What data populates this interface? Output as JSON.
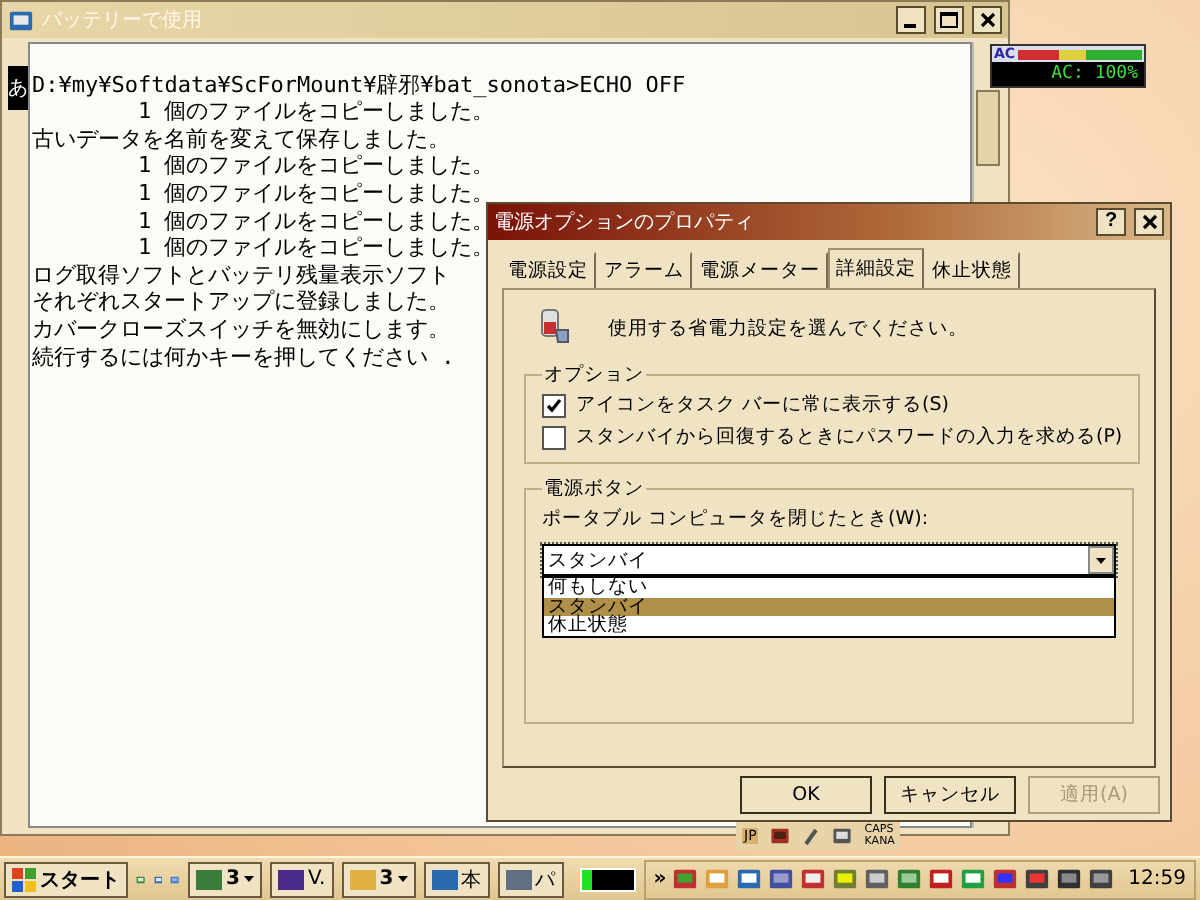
{
  "console": {
    "title": "バッテリーで使用",
    "ime": "あ",
    "lines": [
      "D:¥my¥Softdata¥ScForMount¥辟邪¥bat_sonota>ECHO OFF",
      "        1 個のファイルをコピーしました。",
      "古いデータを名前を変えて保存しました。",
      "        1 個のファイルをコピーしました。",
      "        1 個のファイルをコピーしました。",
      "        1 個のファイルをコピーしました。",
      "        1 個のファイルをコピーしました。",
      "ログ取得ソフトとバッテリ残量表示ソフト",
      "それぞれスタートアップに登録しました。",
      "カバークローズスイッチを無効にします。",
      "続行するには何かキーを押してください ."
    ]
  },
  "battery_meter": {
    "label": "AC",
    "reading": "AC: 100%",
    "level": 1
  },
  "dialog": {
    "title": "電源オプションのプロパティ",
    "help": "?",
    "tabs": [
      {
        "label": "電源設定",
        "selected": false
      },
      {
        "label": "アラーム",
        "selected": false
      },
      {
        "label": "電源メーター",
        "selected": false
      },
      {
        "label": "詳細設定",
        "selected": true
      },
      {
        "label": "休止状態",
        "selected": false
      }
    ],
    "description": "使用する省電力設定を選んでください。",
    "options": {
      "title": "オプション",
      "checkboxes": [
        {
          "label": "アイコンをタスク バーに常に表示する(S)",
          "checked": true
        },
        {
          "label": "スタンバイから回復するときにパスワードの入力を求める(P)",
          "checked": false
        }
      ]
    },
    "power_button": {
      "title": "電源ボタン",
      "label": "ポータブル コンピュータを閉じたとき(W):",
      "value": "スタンバイ",
      "expanded": true,
      "options": [
        {
          "label": "何もしない",
          "selected": false
        },
        {
          "label": "スタンバイ",
          "selected": true
        },
        {
          "label": "休止状態",
          "selected": false
        }
      ]
    },
    "buttons": [
      {
        "label": "OK",
        "disabled": false
      },
      {
        "label": "キャンセル",
        "disabled": false
      },
      {
        "label": "適用(A)",
        "disabled": true
      }
    ]
  },
  "language_bar": {
    "language": "JP",
    "caps": "CAPS",
    "kana": "KANA"
  },
  "taskbar": {
    "start": "スタート",
    "tasks": [
      {
        "label": "3",
        "kind": "group",
        "color": "#3a7d3a"
      },
      {
        "label": "V.",
        "kind": "app",
        "color": "#4a2a8a"
      },
      {
        "label": "3",
        "kind": "group",
        "color": "#e0b040"
      },
      {
        "label": "本",
        "kind": "app",
        "color": "#2a6ab0"
      },
      {
        "label": "パ",
        "kind": "app",
        "color": "#607080"
      }
    ],
    "progress": {
      "level": 0.2
    },
    "chevron": "»",
    "clock": "12:59"
  }
}
